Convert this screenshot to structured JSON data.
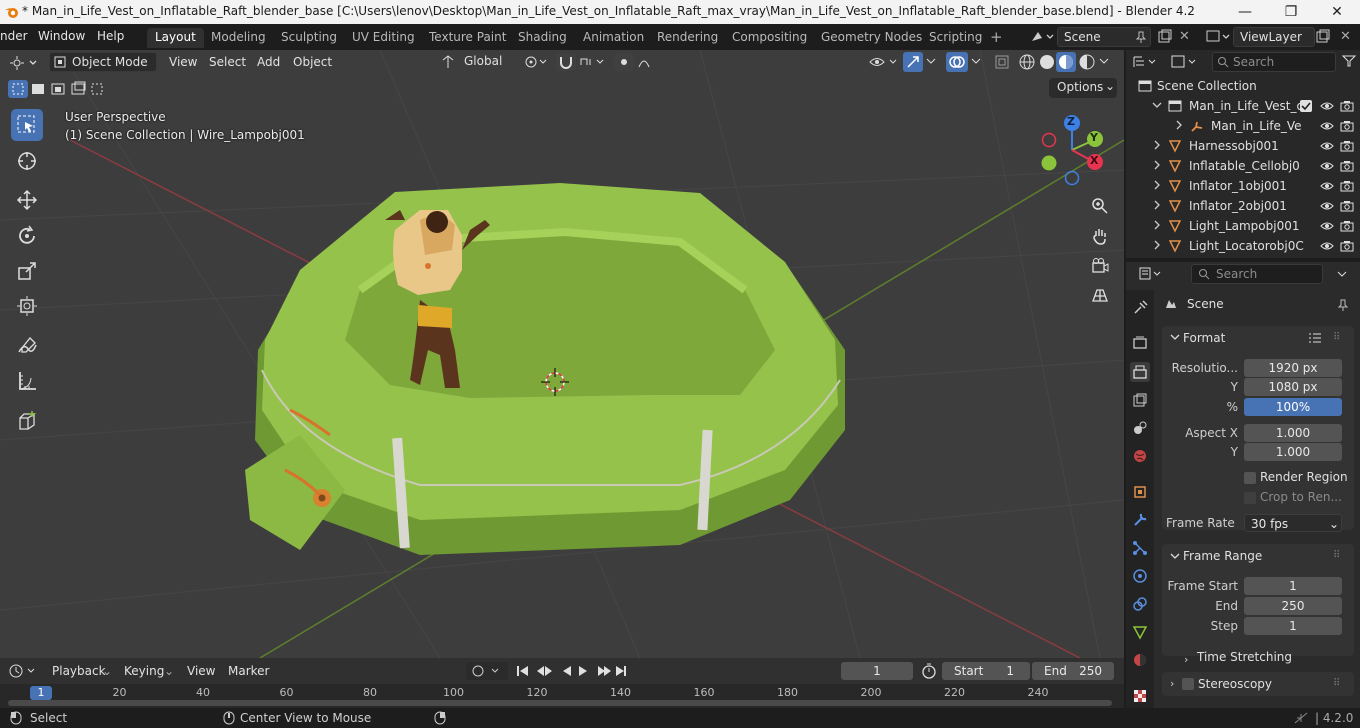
{
  "titlebar": {
    "title": "* Man_in_Life_Vest_on_Inflatable_Raft_blender_base [C:\\Users\\lenov\\Desktop\\Man_in_Life_Vest_on_Inflatable_Raft_max_vray\\Man_in_Life_Vest_on_Inflatable_Raft_blender_base.blend] - Blender 4.2",
    "minimize": "—",
    "maximize": "❐",
    "close": "✕"
  },
  "menu": [
    "nder",
    "Window",
    "Help"
  ],
  "workspaces": [
    "Layout",
    "Modeling",
    "Sculpting",
    "UV Editing",
    "Texture Paint",
    "Shading",
    "Animation",
    "Rendering",
    "Compositing",
    "Geometry Nodes",
    "Scripting"
  ],
  "active_workspace": "Layout",
  "scene_selector": {
    "value": "Scene"
  },
  "view_layer": {
    "value": "ViewLayer"
  },
  "viewport_header": {
    "mode": "Object Mode",
    "menus": [
      "View",
      "Select",
      "Add",
      "Object"
    ],
    "transform_orientation": "Global",
    "options": "Options"
  },
  "viewport_overlay": {
    "perspective": "User Perspective",
    "collection_info": "(1) Scene Collection | Wire_Lampobj001"
  },
  "gizmo": {
    "z": "Z",
    "y": "Y",
    "x": "X"
  },
  "outliner": {
    "search_placeholder": "Search",
    "root": "Scene Collection",
    "items": [
      {
        "name": "Man_in_Life_Vest_o",
        "indent": 1,
        "type": "collection",
        "expanded": true
      },
      {
        "name": "Man_in_Life_Ve",
        "indent": 2,
        "type": "armature",
        "expanded": false
      },
      {
        "name": "Harnessobj001",
        "indent": 1,
        "type": "mesh",
        "expanded": false
      },
      {
        "name": "Inflatable_Cellobj0",
        "indent": 1,
        "type": "mesh",
        "expanded": false
      },
      {
        "name": "Inflator_1obj001",
        "indent": 1,
        "type": "mesh",
        "expanded": false
      },
      {
        "name": "Inflator_2obj001",
        "indent": 1,
        "type": "mesh",
        "expanded": false
      },
      {
        "name": "Light_Lampobj001",
        "indent": 1,
        "type": "mesh",
        "expanded": false
      },
      {
        "name": "Light_Locatorobj0C",
        "indent": 1,
        "type": "mesh",
        "expanded": false
      }
    ]
  },
  "properties": {
    "search_placeholder": "Search",
    "context": "Scene",
    "format": {
      "header": "Format",
      "resolution_label": "Resolutio...",
      "resolution_x": "1920 px",
      "y_label": "Y",
      "resolution_y": "1080 px",
      "percent_label": "%",
      "percent": "100%",
      "aspect_x_label": "Aspect X",
      "aspect_x": "1.000",
      "aspect_y_label": "Y",
      "aspect_y": "1.000",
      "render_region": "Render Region",
      "crop_to_render": "Crop to Ren...",
      "frame_rate_label": "Frame Rate",
      "frame_rate": "30 fps"
    },
    "frame_range": {
      "header": "Frame Range",
      "start_label": "Frame Start",
      "start": "1",
      "end_label": "End",
      "end": "250",
      "step_label": "Step",
      "step": "1",
      "time_stretching": "Time Stretching"
    },
    "stereoscopy": "Stereoscopy"
  },
  "timeline": {
    "menus": [
      "Playback",
      "Keying",
      "View",
      "Marker"
    ],
    "current_frame": "1",
    "start_label": "Start",
    "start": "1",
    "end_label": "End",
    "end": "250",
    "ruler": [
      "1",
      "20",
      "40",
      "60",
      "80",
      "100",
      "120",
      "140",
      "160",
      "180",
      "200",
      "220",
      "240"
    ]
  },
  "statusbar": {
    "select": "Select",
    "center_view": "Center View to Mouse",
    "version": "4.2.0"
  },
  "colors": {
    "accent": "#4772b3",
    "raft": "#8fbc45",
    "axis_x": "#e8344f",
    "axis_y": "#8bc43a",
    "axis_z": "#3d80e6"
  }
}
